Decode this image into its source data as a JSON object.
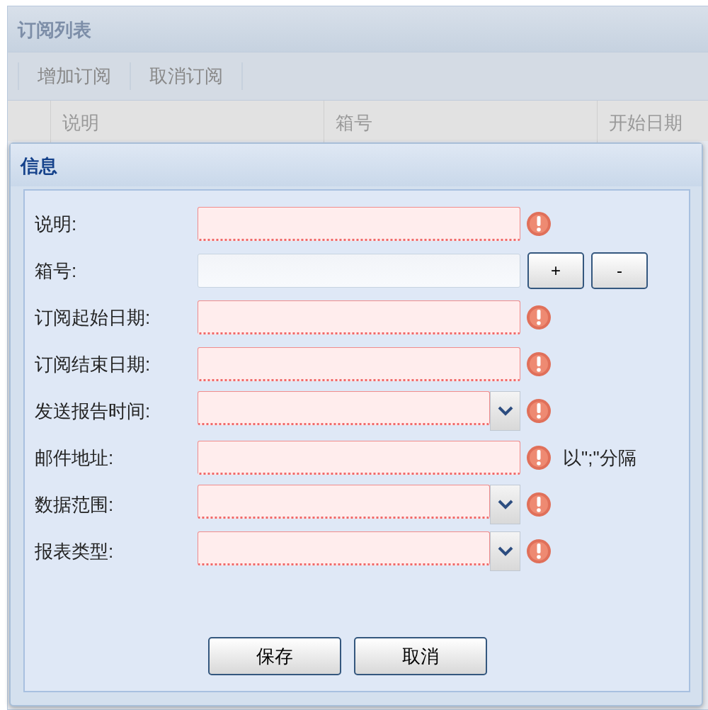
{
  "list_panel": {
    "title": "订阅列表",
    "toolbar": [
      "增加订阅",
      "取消订阅"
    ],
    "columns": [
      "说明",
      "箱号",
      "开始日期"
    ]
  },
  "dialog": {
    "title": "信息",
    "fields": [
      {
        "label": "说明:",
        "kind": "text",
        "invalid": true
      },
      {
        "label": "箱号:",
        "kind": "box",
        "invalid": false,
        "buttons": [
          "+",
          "-"
        ]
      },
      {
        "label": "订阅起始日期:",
        "kind": "text",
        "invalid": true
      },
      {
        "label": "订阅结束日期:",
        "kind": "text",
        "invalid": true
      },
      {
        "label": "发送报告时间:",
        "kind": "combo",
        "invalid": true
      },
      {
        "label": "邮件地址:",
        "kind": "text",
        "invalid": true,
        "hint": "以\";\"分隔"
      },
      {
        "label": "数据范围:",
        "kind": "combo",
        "invalid": true
      },
      {
        "label": "报表类型:",
        "kind": "combo",
        "invalid": true
      }
    ],
    "buttons": [
      "保存",
      "取消"
    ]
  }
}
